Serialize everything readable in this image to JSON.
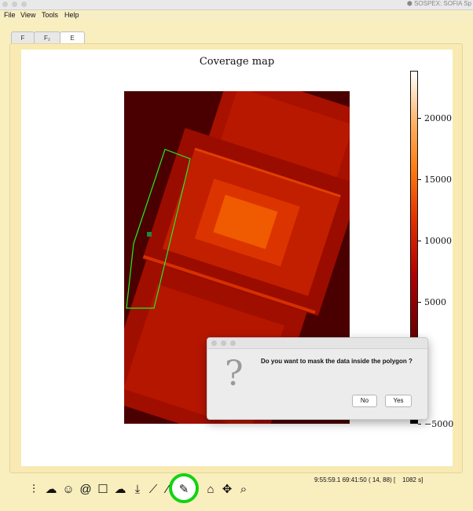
{
  "window": {
    "title": "SOSPEX: SOFIA Sp"
  },
  "menu": {
    "file": "File",
    "view": "View",
    "tools": "Tools",
    "help": "Help"
  },
  "tabs": [
    {
      "label": "F",
      "active": false
    },
    {
      "label": "F₂",
      "active": false
    },
    {
      "label": "E",
      "active": true
    }
  ],
  "plot": {
    "title": "Coverage map",
    "colorbar": {
      "ticks": [
        "20000",
        "15000",
        "10000",
        "5000",
        "−5000"
      ],
      "colormap": "gist_heat"
    }
  },
  "dialog": {
    "icon": "question-icon",
    "message": "Do you want to mask the data inside the polygon ?",
    "no_label": "No",
    "yes_label": "Yes"
  },
  "status": {
    "text": "9:55:59.1 69:41:50 ( 14, 88) [    1082 s]"
  },
  "toolbar": {
    "icons": [
      "sliders-icon",
      "cloud-wave-icon",
      "smiley-icon",
      "spiral-icon",
      "note-icon",
      "cloud-icon",
      "download-icon",
      "fit-line-icon",
      "slope-icon",
      "eraser-icon",
      "home-icon",
      "move-icon",
      "zoom-icon"
    ],
    "highlighted": "eraser-icon"
  },
  "colors": {
    "background": "#f9eebe",
    "highlight": "#12d312",
    "polygon": "#22ee22"
  }
}
